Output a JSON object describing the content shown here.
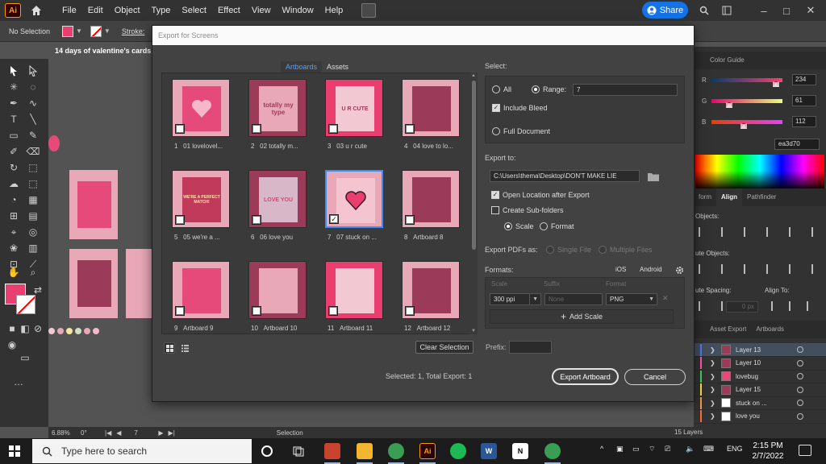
{
  "app": {
    "logo": "Ai",
    "menu": [
      "File",
      "Edit",
      "Object",
      "Type",
      "Select",
      "Effect",
      "View",
      "Window",
      "Help"
    ],
    "share_label": "Share",
    "control_bar": {
      "no_selection": "No Selection",
      "stroke_label": "Stroke:"
    },
    "doc_title": "14 days of valentine's cards.ai",
    "fill_color": "#ea3d70"
  },
  "right_panel": {
    "color_tabs": [
      "",
      "Color Guide"
    ],
    "rgb": [
      {
        "label": "R",
        "value": "234"
      },
      {
        "label": "G",
        "value": "61"
      },
      {
        "label": "B",
        "value": "112"
      }
    ],
    "hex": "ea3d70",
    "align_tabs": [
      "form",
      "Align",
      "Pathfinder"
    ],
    "align_objects": "Objects:",
    "distribute_objects": "ute Objects:",
    "distribute_spacing": "ute Spacing:",
    "align_to": "Align To:",
    "spacing_value": "0 px",
    "layers_tabs": [
      "",
      "Asset Export",
      "Artboards"
    ],
    "layers": [
      {
        "name": "Layer 13",
        "color": "#4b7bff",
        "thumb": "#9c3a5a"
      },
      {
        "name": "Layer 10",
        "color": "#ff5ab4",
        "thumb": "#9c3a5a"
      },
      {
        "name": "lovebug",
        "color": "#3ed65a",
        "thumb": "#e64a7a"
      },
      {
        "name": "Layer 15",
        "color": "#ffe14a",
        "thumb": "#9c3a5a"
      },
      {
        "name": "stuck on ...",
        "color": "#ff9a3a",
        "thumb": "#ffffff"
      },
      {
        "name": "love you",
        "color": "#ff6a2a",
        "thumb": "#ffffff"
      }
    ],
    "layers_count": "15 Layers"
  },
  "status": {
    "zoom": "6.88%",
    "angle": "0°",
    "page": "7",
    "mode": "Selection"
  },
  "dialog": {
    "title": "Export for Screens",
    "tabs": [
      "Artboards",
      "Assets"
    ],
    "thumbs": [
      {
        "num": "1",
        "name": "01 lovelovel...",
        "bg": "#e8a8b8",
        "card": "#e64a7a",
        "checked": false,
        "selected": false
      },
      {
        "num": "2",
        "name": "02 totally m...",
        "bg": "#9c3a5a",
        "card": "#e8a8b8",
        "checked": false,
        "selected": false
      },
      {
        "num": "3",
        "name": "03 u r cute",
        "bg": "#ea3d70",
        "card": "#f2c8d2",
        "checked": false,
        "selected": false
      },
      {
        "num": "4",
        "name": "04 love to lo...",
        "bg": "#e8a8b8",
        "card": "#9c3a5a",
        "checked": false,
        "selected": false
      },
      {
        "num": "5",
        "name": "05 we're a ...",
        "bg": "#e8a8b8",
        "card": "#c13a5c",
        "checked": false,
        "selected": false
      },
      {
        "num": "6",
        "name": "06 love you",
        "bg": "#9c3a5a",
        "card": "#d8b8c8",
        "checked": false,
        "selected": false
      },
      {
        "num": "7",
        "name": "07 stuck on ...",
        "bg": "#e8a8b8",
        "card": "#f4c4d0",
        "checked": true,
        "selected": true
      },
      {
        "num": "8",
        "name": "Artboard 8",
        "bg": "#e8a8b8",
        "card": "#9c3a5a",
        "checked": false,
        "selected": false
      },
      {
        "num": "9",
        "name": "Artboard 9",
        "bg": "#e8a8b8",
        "card": "#e64a7a",
        "checked": false,
        "selected": false
      },
      {
        "num": "10",
        "name": "Artboard 10",
        "bg": "#9c3a5a",
        "card": "#e8a8b8",
        "checked": false,
        "selected": false
      },
      {
        "num": "11",
        "name": "Artboard 11",
        "bg": "#ea3d70",
        "card": "#f2c8d2",
        "checked": false,
        "selected": false
      },
      {
        "num": "12",
        "name": "Artboard 12",
        "bg": "#e8a8b8",
        "card": "#9c3a5a",
        "checked": false,
        "selected": false
      }
    ],
    "thumb_texts": {
      "t2": "totally my type",
      "t3": "U R CUTE",
      "t5": "WE'RE A PERFECT MATCH!",
      "t6": "LOVE YOU"
    },
    "clear_selection": "Clear Selection",
    "prefix_label": "Prefix:",
    "prefix_value": "",
    "summary": "Selected: 1, Total Export: 1",
    "export_button": "Export Artboard",
    "cancel_button": "Cancel",
    "select_label": "Select:",
    "all_label": "All",
    "range_label": "Range:",
    "range_value": "7",
    "include_bleed": "Include Bleed",
    "full_document": "Full Document",
    "export_to_label": "Export to:",
    "export_path": "C:\\Users\\thema\\Desktop\\DON'T MAKE LIE",
    "open_location": "Open Location after Export",
    "create_subfolders": "Create Sub-folders",
    "scale_label": "Scale",
    "format_label": "Format",
    "export_pdfs_label": "Export PDFs as:",
    "single_file": "Single File",
    "multiple_files": "Multiple Files",
    "formats_label": "Formats:",
    "ios": "iOS",
    "android": "Android",
    "col_scale": "Scale",
    "col_suffix": "Suffix",
    "col_format": "Format",
    "scale_value": "300 ppi",
    "suffix_placeholder": "None",
    "format_value": "PNG",
    "add_scale": "Add Scale"
  },
  "taskbar": {
    "search_placeholder": "Type here to search",
    "lang": "ENG",
    "time": "2:15 PM",
    "date": "2/7/2022",
    "apps": [
      {
        "name": "acrobat",
        "color": "#c8442f",
        "glyph": ""
      },
      {
        "name": "explorer",
        "color": "#f2b731",
        "glyph": ""
      },
      {
        "name": "chrome",
        "color": "#3a9d54",
        "glyph": ""
      },
      {
        "name": "illustrator",
        "color": "#2a0000",
        "glyph": "Ai"
      },
      {
        "name": "spotify",
        "color": "#1db954",
        "glyph": ""
      },
      {
        "name": "word",
        "color": "#2b5797",
        "glyph": "W"
      },
      {
        "name": "notion",
        "color": "#ffffff",
        "glyph": "N"
      },
      {
        "name": "chrome-profile",
        "color": "#3a9d54",
        "glyph": ""
      }
    ]
  }
}
